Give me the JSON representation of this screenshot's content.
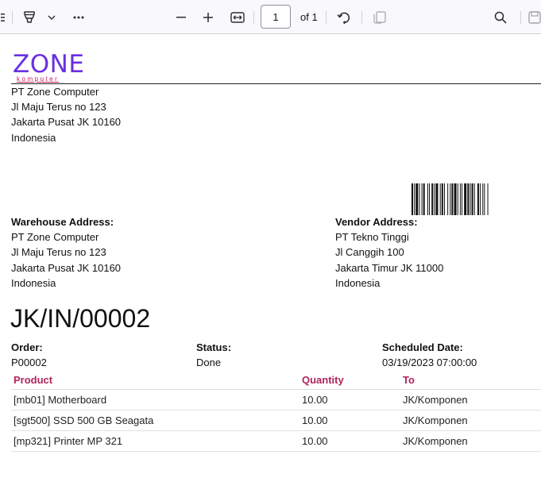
{
  "toolbar": {
    "page_number": "1",
    "page_of": "of 1",
    "icons": [
      "sidebar-toggle-icon",
      "highlight-pen-icon",
      "chevron-down-icon",
      "more-icon",
      "zoom-out-icon",
      "zoom-in-icon",
      "fit-width-icon",
      "rotate-icon",
      "page-view-icon",
      "search-icon",
      "save-icon"
    ]
  },
  "document": {
    "logo": {
      "main": "ZONE",
      "sub": "komputer",
      "color": "#6b2fe0",
      "sub_color": "#c2185b"
    },
    "company": [
      "PT Zone Computer",
      "Jl Maju Terus no 123",
      "Jakarta Pusat JK 10160",
      "Indonesia"
    ],
    "warehouse": {
      "label": "Warehouse Address:",
      "lines": [
        "PT Zone Computer",
        "Jl Maju Terus no 123",
        "Jakarta Pusat JK 10160",
        "Indonesia"
      ]
    },
    "vendor": {
      "label": "Vendor Address:",
      "lines": [
        "PT Tekno Tinggi",
        "Jl Canggih 100",
        "Jakarta Timur JK 11000",
        "Indonesia"
      ]
    },
    "reference": "JK/IN/00002",
    "order": {
      "label": "Order:",
      "value": "P00002"
    },
    "status": {
      "label": "Status:",
      "value": "Done"
    },
    "scheduled": {
      "label": "Scheduled Date:",
      "value": "03/19/2023 07:00:00"
    },
    "table": {
      "headers": {
        "product": "Product",
        "quantity": "Quantity",
        "to": "To"
      },
      "header_color": "#b0245a",
      "rows": [
        {
          "product": "[mb01] Motherboard",
          "quantity": "10.00",
          "to": "JK/Komponen"
        },
        {
          "product": "[sgt500] SSD 500 GB Seagata",
          "quantity": "10.00",
          "to": "JK/Komponen"
        },
        {
          "product": "[mp321] Printer MP 321",
          "quantity": "10.00",
          "to": "JK/Komponen"
        }
      ]
    }
  }
}
